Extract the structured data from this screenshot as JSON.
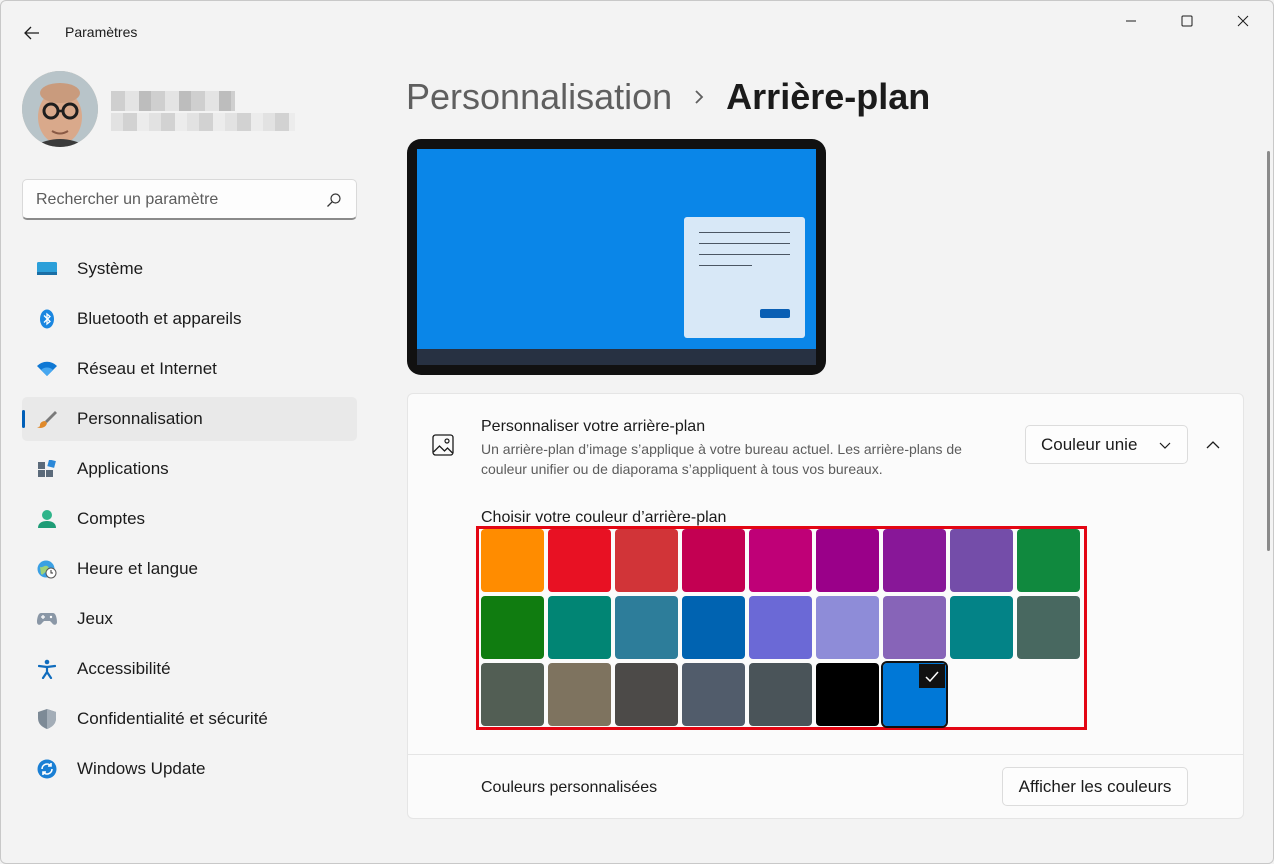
{
  "window": {
    "app_title": "Paramètres"
  },
  "search": {
    "placeholder": "Rechercher un paramètre"
  },
  "sidebar": {
    "items": [
      {
        "label": "Système",
        "icon": "system-icon"
      },
      {
        "label": "Bluetooth et appareils",
        "icon": "bluetooth-icon"
      },
      {
        "label": "Réseau et Internet",
        "icon": "wifi-icon"
      },
      {
        "label": "Personnalisation",
        "icon": "brush-icon",
        "active": true
      },
      {
        "label": "Applications",
        "icon": "apps-icon"
      },
      {
        "label": "Comptes",
        "icon": "account-icon"
      },
      {
        "label": "Heure et langue",
        "icon": "time-language-icon"
      },
      {
        "label": "Jeux",
        "icon": "gamepad-icon"
      },
      {
        "label": "Accessibilité",
        "icon": "accessibility-icon"
      },
      {
        "label": "Confidentialité et sécurité",
        "icon": "shield-icon"
      },
      {
        "label": "Windows Update",
        "icon": "update-icon"
      }
    ]
  },
  "breadcrumb": {
    "parent": "Personnalisation",
    "current": "Arrière-plan"
  },
  "background_card": {
    "title": "Personnaliser votre arrière-plan",
    "description": "Un arrière-plan d’image s’applique à votre bureau actuel. Les arrière-plans de couleur unifier ou de diaporama s’appliquent à tous vos bureaux.",
    "dropdown_value": "Couleur unie"
  },
  "colors": {
    "label": "Choisir votre couleur d’arrière-plan",
    "selected_index": 24,
    "swatches": [
      "#ff8c00",
      "#e81123",
      "#d13438",
      "#c30052",
      "#bf0077",
      "#9a0089",
      "#881798",
      "#744da9",
      "#10893e",
      "#107c10",
      "#018574",
      "#2d7d9a",
      "#0063b1",
      "#6b69d6",
      "#8e8cd8",
      "#8764b8",
      "#038387",
      "#486860",
      "#525e54",
      "#7e735f",
      "#4c4a48",
      "#515c6b",
      "#4a5459",
      "#000000",
      "#0078d7"
    ]
  },
  "custom_colors": {
    "label": "Couleurs personnalisées",
    "button_label": "Afficher les couleurs"
  },
  "preview": {
    "screen_color": "#0a86e8",
    "taskbar_color": "#273142"
  },
  "accent_color": "#005fb8",
  "highlight_color": "#e30613"
}
